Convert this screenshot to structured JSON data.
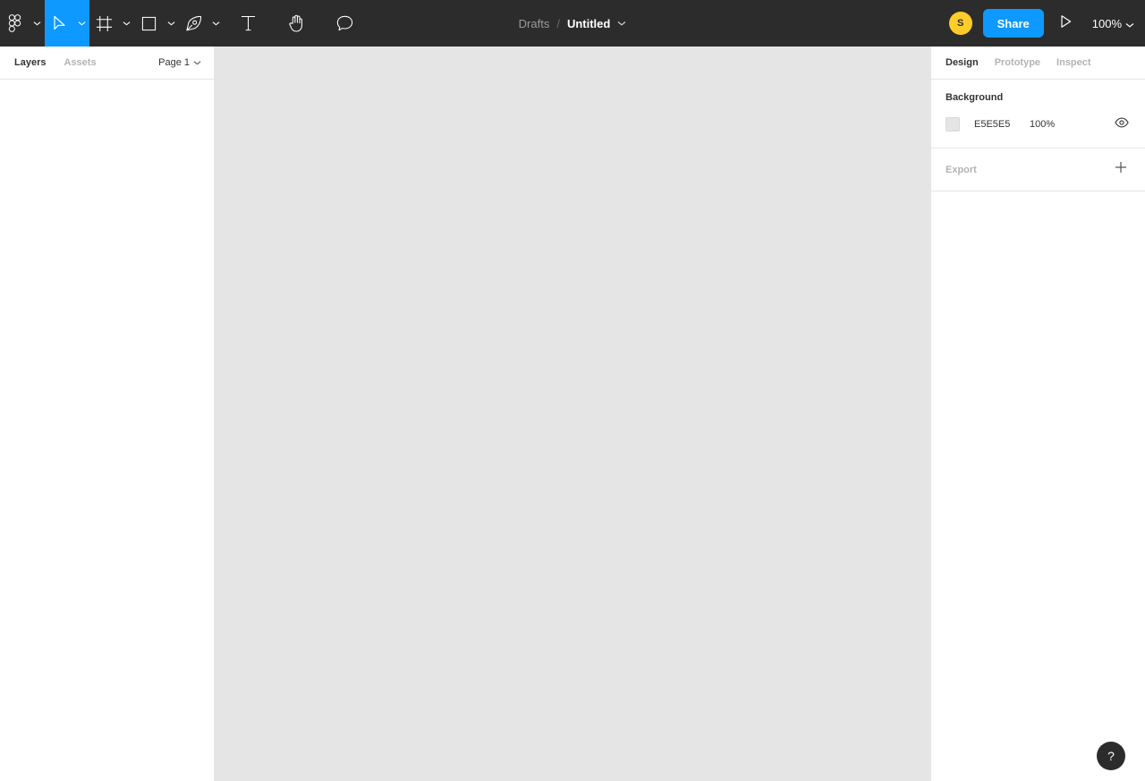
{
  "app": {
    "name": "Figma",
    "accent_blue": "#0D99FF",
    "toolbar_bg": "#2C2C2C",
    "canvas_bg": "#E5E5E5",
    "avatar_color": "#FFCD29"
  },
  "toolbar": {
    "tools": [
      {
        "id": "main-menu",
        "icon": "figma-logo-icon",
        "label": "Figma menu",
        "has_caret": true,
        "active": false
      },
      {
        "id": "move",
        "icon": "cursor-arrow-icon",
        "label": "Move",
        "has_caret": true,
        "active": true
      },
      {
        "id": "frame",
        "icon": "frame-icon",
        "label": "Frame",
        "has_caret": true,
        "active": false
      },
      {
        "id": "shape",
        "icon": "rectangle-icon",
        "label": "Shape",
        "has_caret": true,
        "active": false
      },
      {
        "id": "pen",
        "icon": "pen-icon",
        "label": "Pen",
        "has_caret": true,
        "active": false
      },
      {
        "id": "text",
        "icon": "text-icon",
        "label": "Text",
        "has_caret": false,
        "active": false
      },
      {
        "id": "hand",
        "icon": "hand-icon",
        "label": "Hand",
        "has_caret": false,
        "active": false
      },
      {
        "id": "comment",
        "icon": "comment-icon",
        "label": "Comment",
        "has_caret": false,
        "active": false
      }
    ],
    "breadcrumb": {
      "parent": "Drafts",
      "separator": "/",
      "file_name": "Untitled",
      "caret_icon": "chevron-down-icon"
    },
    "avatar_initial": "S",
    "share_label": "Share",
    "present_icon": "play-icon",
    "zoom_level": "100%",
    "zoom_caret_icon": "chevron-down-icon"
  },
  "left_panel": {
    "tabs": [
      {
        "label": "Layers",
        "active": true
      },
      {
        "label": "Assets",
        "active": false
      }
    ],
    "page_selector": {
      "label": "Page 1",
      "caret_icon": "chevron-down-icon"
    },
    "layers": []
  },
  "right_panel": {
    "tabs": [
      {
        "label": "Design",
        "active": true
      },
      {
        "label": "Prototype",
        "active": false
      },
      {
        "label": "Inspect",
        "active": false
      }
    ],
    "background": {
      "title": "Background",
      "swatch_color": "#E5E5E5",
      "hex": "E5E5E5",
      "opacity": "100%",
      "visibility_icon": "eye-icon"
    },
    "export": {
      "title": "Export",
      "add_icon": "plus-icon"
    }
  },
  "help": {
    "label": "?",
    "icon": "question-mark-icon"
  }
}
